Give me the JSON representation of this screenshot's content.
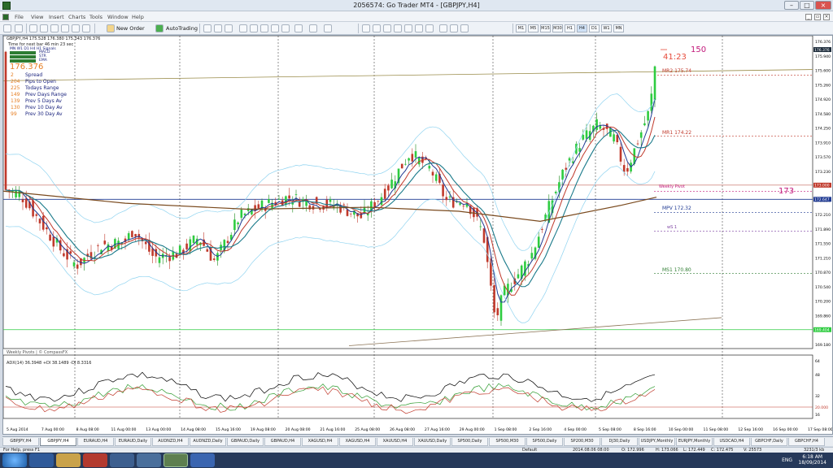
{
  "window": {
    "title": "2056574: Go Trader MT4 - [GBPJPY,H4]"
  },
  "menu": [
    "File",
    "View",
    "Insert",
    "Charts",
    "Tools",
    "Window",
    "Help"
  ],
  "toolbar": {
    "new_order_label": "New Order",
    "autotrading_label": "AutoTrading",
    "timeframes": [
      "M1",
      "M5",
      "M15",
      "M30",
      "H1",
      "H4",
      "D1",
      "W1",
      "MN"
    ]
  },
  "chart": {
    "symbol_header": "GBPJPY,H4  175.528 176.380 175.343 176.376",
    "time_to_next": "Time for next bar 46 min 23 sec",
    "indicator_tf_row": "MN  W1  D1  H4  H1  Signals",
    "indicator_rows": [
      "MACD",
      "STR",
      "EMA"
    ],
    "big_price": "176.376",
    "info_rows": [
      {
        "value": "2",
        "label": "Spread"
      },
      {
        "value": "204",
        "label": "Pips to Open"
      },
      {
        "value": "225",
        "label": "Todays Range"
      },
      {
        "value": "149",
        "label": "Prev Days Range"
      },
      {
        "value": "139",
        "label": "Prev 5 Days Av"
      },
      {
        "value": "130",
        "label": "Prev 10 Day Av"
      },
      {
        "value": "99",
        "label": "Prev 30 Day Av"
      }
    ],
    "countdown": "41:23",
    "annotation_150": "150",
    "annotation_173": "173",
    "pivots": [
      {
        "label": "MR2  175.74",
        "price": 175.74
      },
      {
        "label": "MR1  174.22",
        "price": 174.22
      },
      {
        "label": "Weekly Pivot",
        "price": 172.85
      },
      {
        "label": "MPV  172.32",
        "price": 172.32
      },
      {
        "label": "wS 1",
        "price": 171.85
      },
      {
        "label": "MS1  170.80",
        "price": 170.8
      }
    ],
    "footer_label": "Weekly Pivots | © CompassFX",
    "price_axis": [
      "176.376",
      "175.940",
      "175.600",
      "175.260",
      "174.920",
      "174.580",
      "174.250",
      "173.910",
      "173.570",
      "173.230",
      "172.890",
      "172.550",
      "172.210",
      "171.890",
      "171.550",
      "171.210",
      "170.870",
      "170.540",
      "170.200",
      "169.860",
      "169.520",
      "169.180"
    ],
    "price_range": [
      168.95,
      176.66
    ],
    "price_flags": [
      {
        "text": "176.376",
        "price": 176.376,
        "color": "#1c2b3a"
      },
      {
        "text": "173.000",
        "price": 173.0,
        "color": "#c0392b"
      },
      {
        "text": "172.647",
        "price": 172.647,
        "color": "#1f3a93"
      },
      {
        "text": "169.404",
        "price": 169.4,
        "color": "#2ecc40"
      }
    ],
    "adx_label": "ADX(14) 36.3948 +DI 38.1489 -DI 8.3316",
    "adx_axis": [
      "64",
      "48",
      "32",
      "20.000",
      "16"
    ],
    "time_axis": [
      "5 Aug 2014",
      "7 Aug 00:00",
      "8 Aug 08:00",
      "11 Aug 00:00",
      "13 Aug 00:00",
      "14 Aug 08:00",
      "15 Aug 16:00",
      "19 Aug 08:00",
      "20 Aug 08:00",
      "21 Aug 16:00",
      "25 Aug 08:00",
      "26 Aug 08:00",
      "27 Aug 16:00",
      "29 Aug 00:00",
      "1 Sep 08:00",
      "2 Sep 16:00",
      "4 Sep 00:00",
      "5 Sep 08:00",
      "8 Sep 16:00",
      "10 Sep 00:00",
      "11 Sep 08:00",
      "12 Sep 16:00",
      "16 Sep 00:00",
      "17 Sep 08:00"
    ]
  },
  "symbol_tabs": [
    "GBPJPY,H4",
    "GBPJPY,H4",
    "EURAUD,H4",
    "EURAUD,Daily",
    "AUDNZD,H4",
    "AUDNZD,Daily",
    "GBPAUD,Daily",
    "GBPAUD,H4",
    "XAGUSD,H4",
    "XAGUSD,H4",
    "XAUUSD,H4",
    "XAUUSD,Daily",
    "SP500,Daily",
    "SP500,M30",
    "SP500,Daily",
    "SP200,M30",
    "DJ30,Daily",
    "USDJPY,Monthly",
    "EURJPY,Monthly",
    "USDCAD,H4",
    "GBPCHF,Daily",
    "GBPCHF,H4"
  ],
  "statusbar": {
    "help": "For Help, press F1",
    "profile": "Default",
    "datetime": "2014.08.06 08:00",
    "open": "O: 172.996",
    "high": "H: 173.066",
    "low": "L: 172.449",
    "close": "C: 172.475",
    "volume": "V: 25573",
    "traffic": "3231/3 kb"
  },
  "tray": {
    "lang": "ENG",
    "time": "6:18 AM",
    "date": "18/09/2014"
  }
}
